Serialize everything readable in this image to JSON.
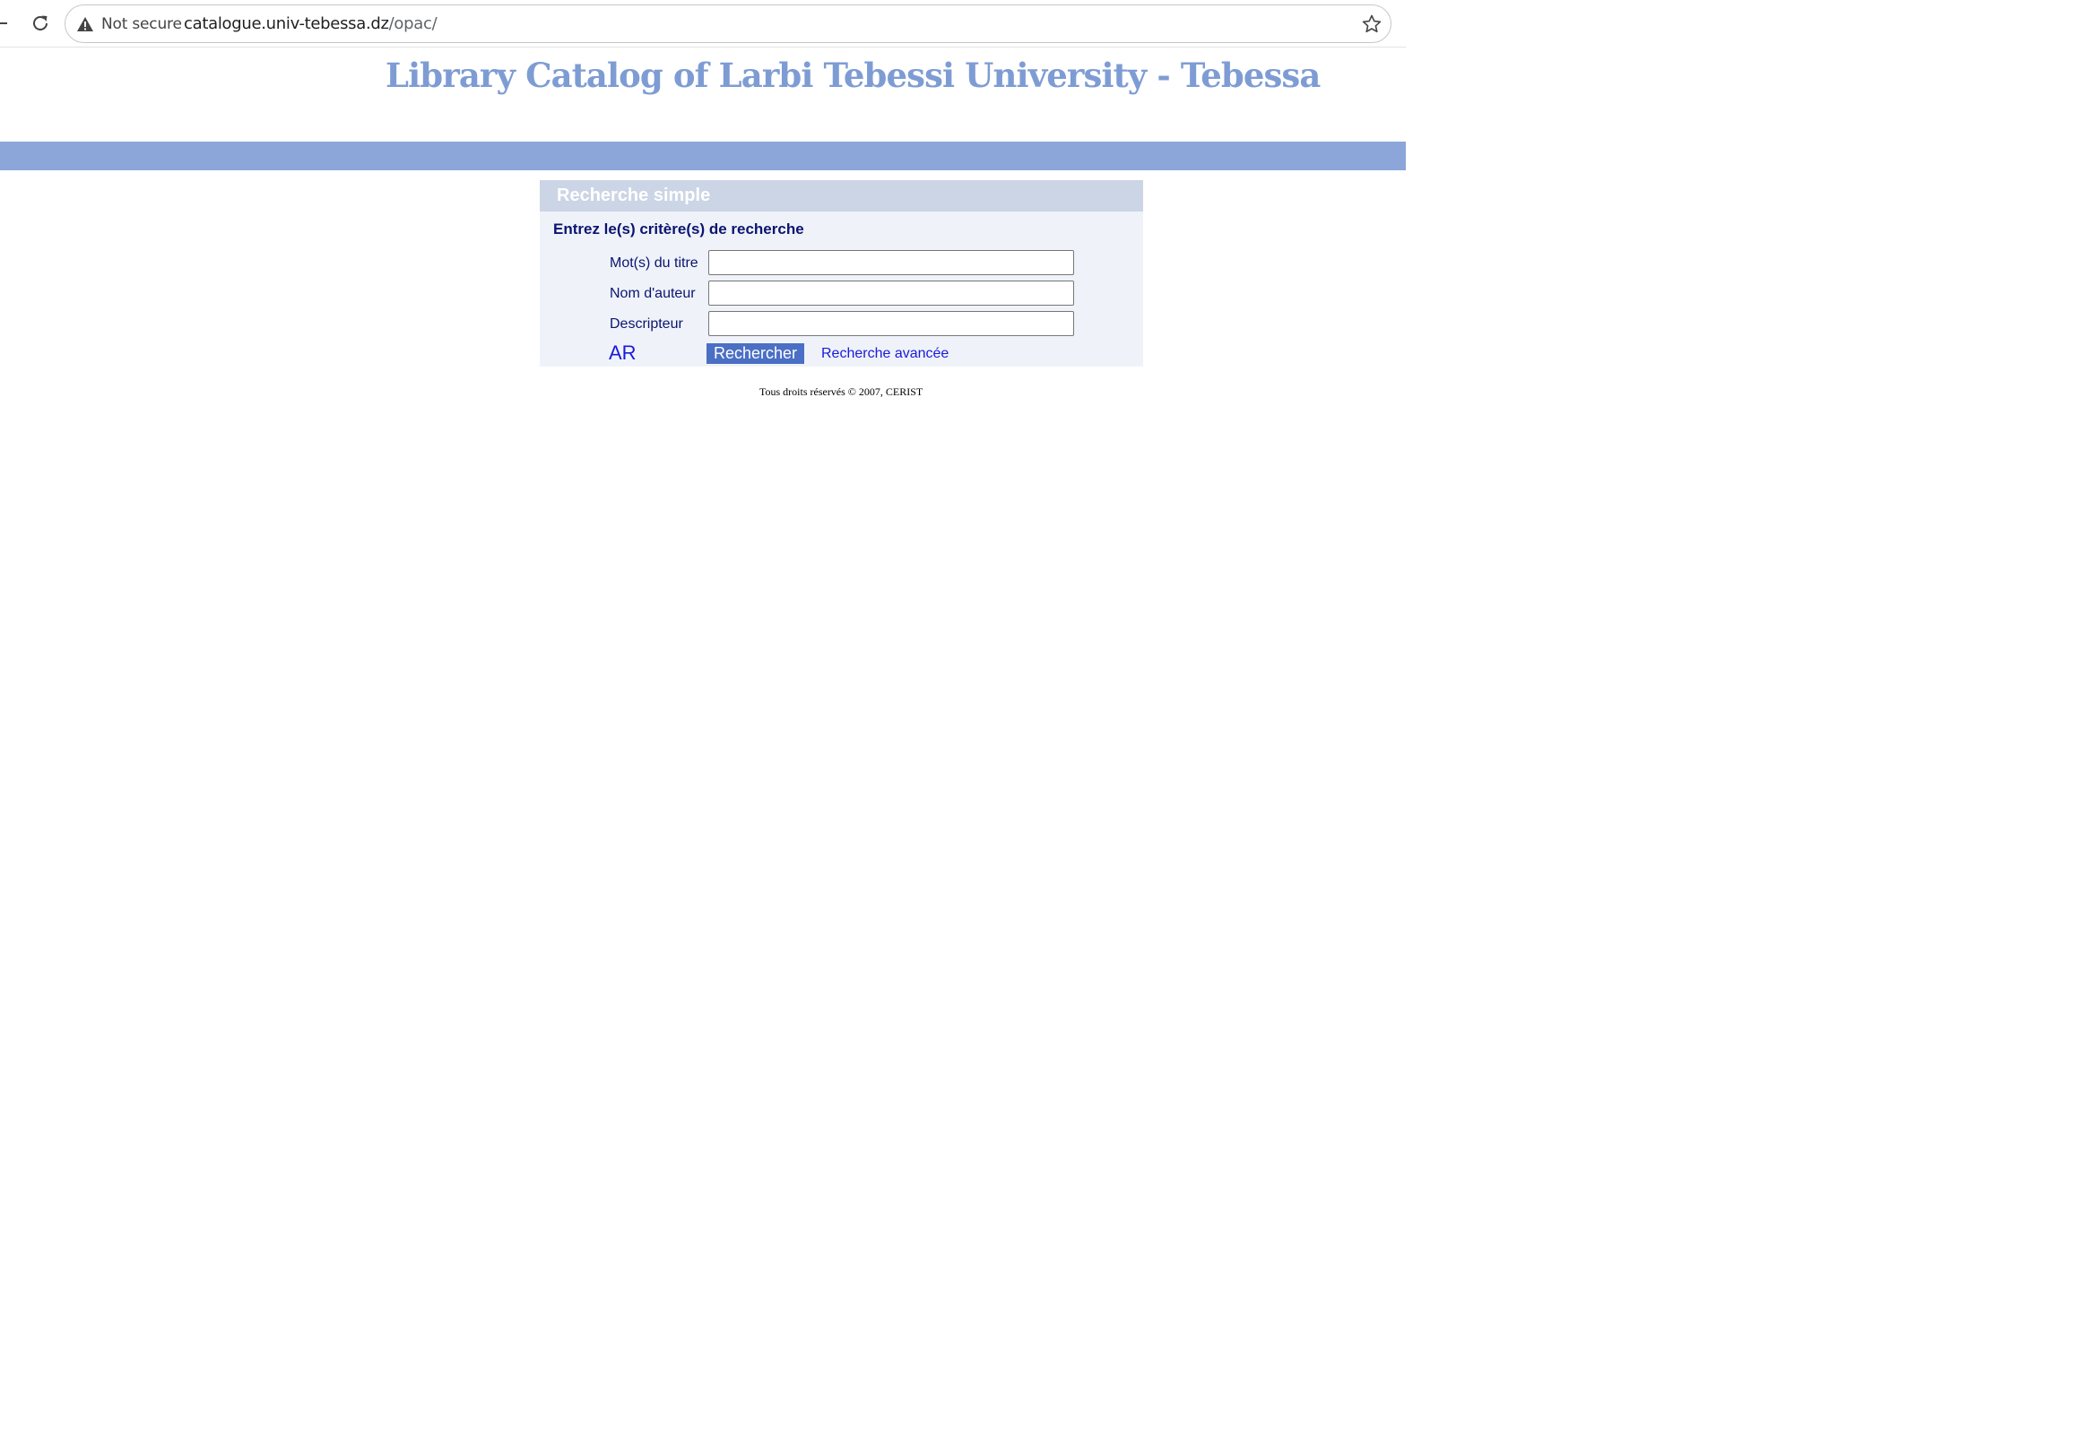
{
  "browser": {
    "security_label": "Not secure",
    "url_host": "catalogue.univ-tebessa.dz",
    "url_path": "/opac/"
  },
  "header": {
    "title": "Library Catalog of Larbi Tebessi University - Tebessa"
  },
  "search": {
    "panel_title": "Recherche simple",
    "subtitle": "Entrez le(s) critère(s) de recherche",
    "fields": [
      {
        "label": "Mot(s) du titre",
        "value": ""
      },
      {
        "label": "Nom d'auteur",
        "value": ""
      },
      {
        "label": "Descripteur",
        "value": ""
      }
    ],
    "language_link": "AR",
    "submit_label": "Rechercher",
    "advanced_link": "Recherche avancée"
  },
  "footer": {
    "copyright": "Tous droits réservés © 2007, CERIST"
  },
  "colors": {
    "title": "#7e9cd4",
    "band": "#8ca6da",
    "panel_header": "#cbd5e6",
    "panel_bg": "#eff3f9",
    "label_text": "#0b1470",
    "button_bg": "#4a6fc4",
    "link": "#1a1adb"
  },
  "icons": [
    "back-arrow-icon",
    "reload-icon",
    "warning-icon",
    "star-icon"
  ]
}
